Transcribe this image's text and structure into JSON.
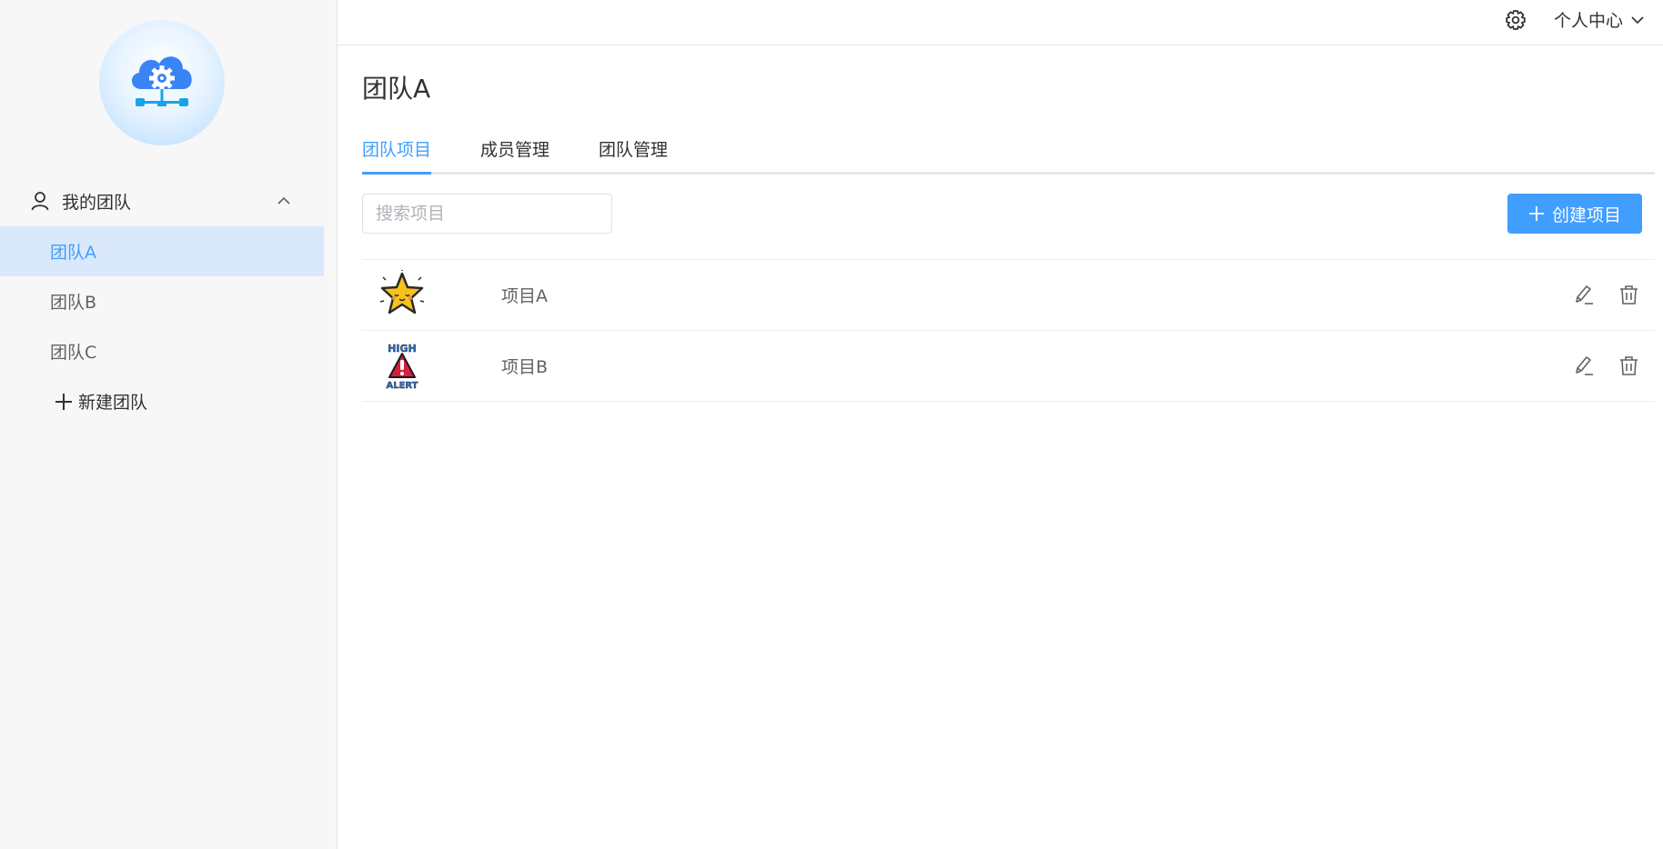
{
  "sidebar": {
    "logo": "cloud-gear-network-logo",
    "group_label": "我的团队",
    "teams": [
      {
        "label": "团队A",
        "active": true
      },
      {
        "label": "团队B",
        "active": false
      },
      {
        "label": "团队C",
        "active": false
      }
    ],
    "new_team_label": "新建团队"
  },
  "header": {
    "settings_icon": "gear-icon",
    "profile_label": "个人中心"
  },
  "main": {
    "title": "团队A",
    "tabs": [
      {
        "label": "团队项目",
        "active": true
      },
      {
        "label": "成员管理",
        "active": false
      },
      {
        "label": "团队管理",
        "active": false
      }
    ],
    "search_placeholder": "搜索项目",
    "search_value": "",
    "create_label": "创建项目",
    "projects": [
      {
        "name": "项目A",
        "thumbnail": "star-sticker-icon"
      },
      {
        "name": "项目B",
        "thumbnail": "high-alert-sticker-icon"
      }
    ]
  },
  "colors": {
    "accent": "#409eff",
    "active_bg": "#d9e9fb",
    "sidebar_bg": "#f7f7f7"
  }
}
